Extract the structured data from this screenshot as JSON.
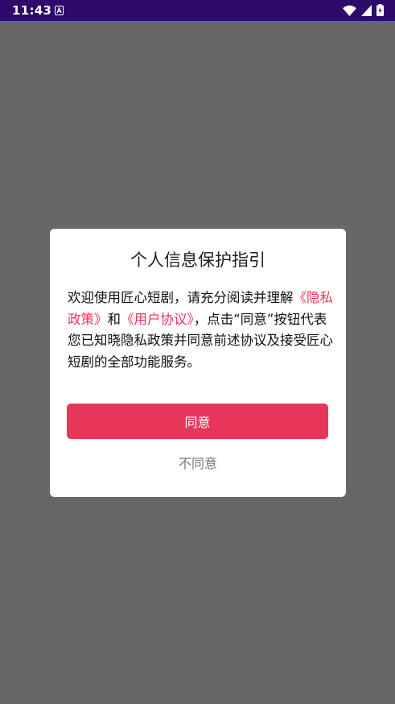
{
  "status_bar": {
    "time": "11:43",
    "notification_icon": "a-letter-icon",
    "icons": [
      "wifi-icon",
      "signal-icon",
      "battery-icon"
    ],
    "background": "#2e0a6b"
  },
  "dialog": {
    "title": "个人信息保护指引",
    "body": {
      "part1": "欢迎使用匠心短剧，请充分阅读并理解",
      "privacy_link": "《隐私政策》",
      "part2": "和",
      "user_agreement_link": "《用户协议》",
      "part3": "，点击“同意”按钮代表您已知晓隐私政策并同意前述协议及接受匠心短剧的全部功能服务。"
    },
    "agree_label": "同意",
    "disagree_label": "不同意",
    "accent_color": "#e8355a"
  },
  "overlay_color": "#676767"
}
